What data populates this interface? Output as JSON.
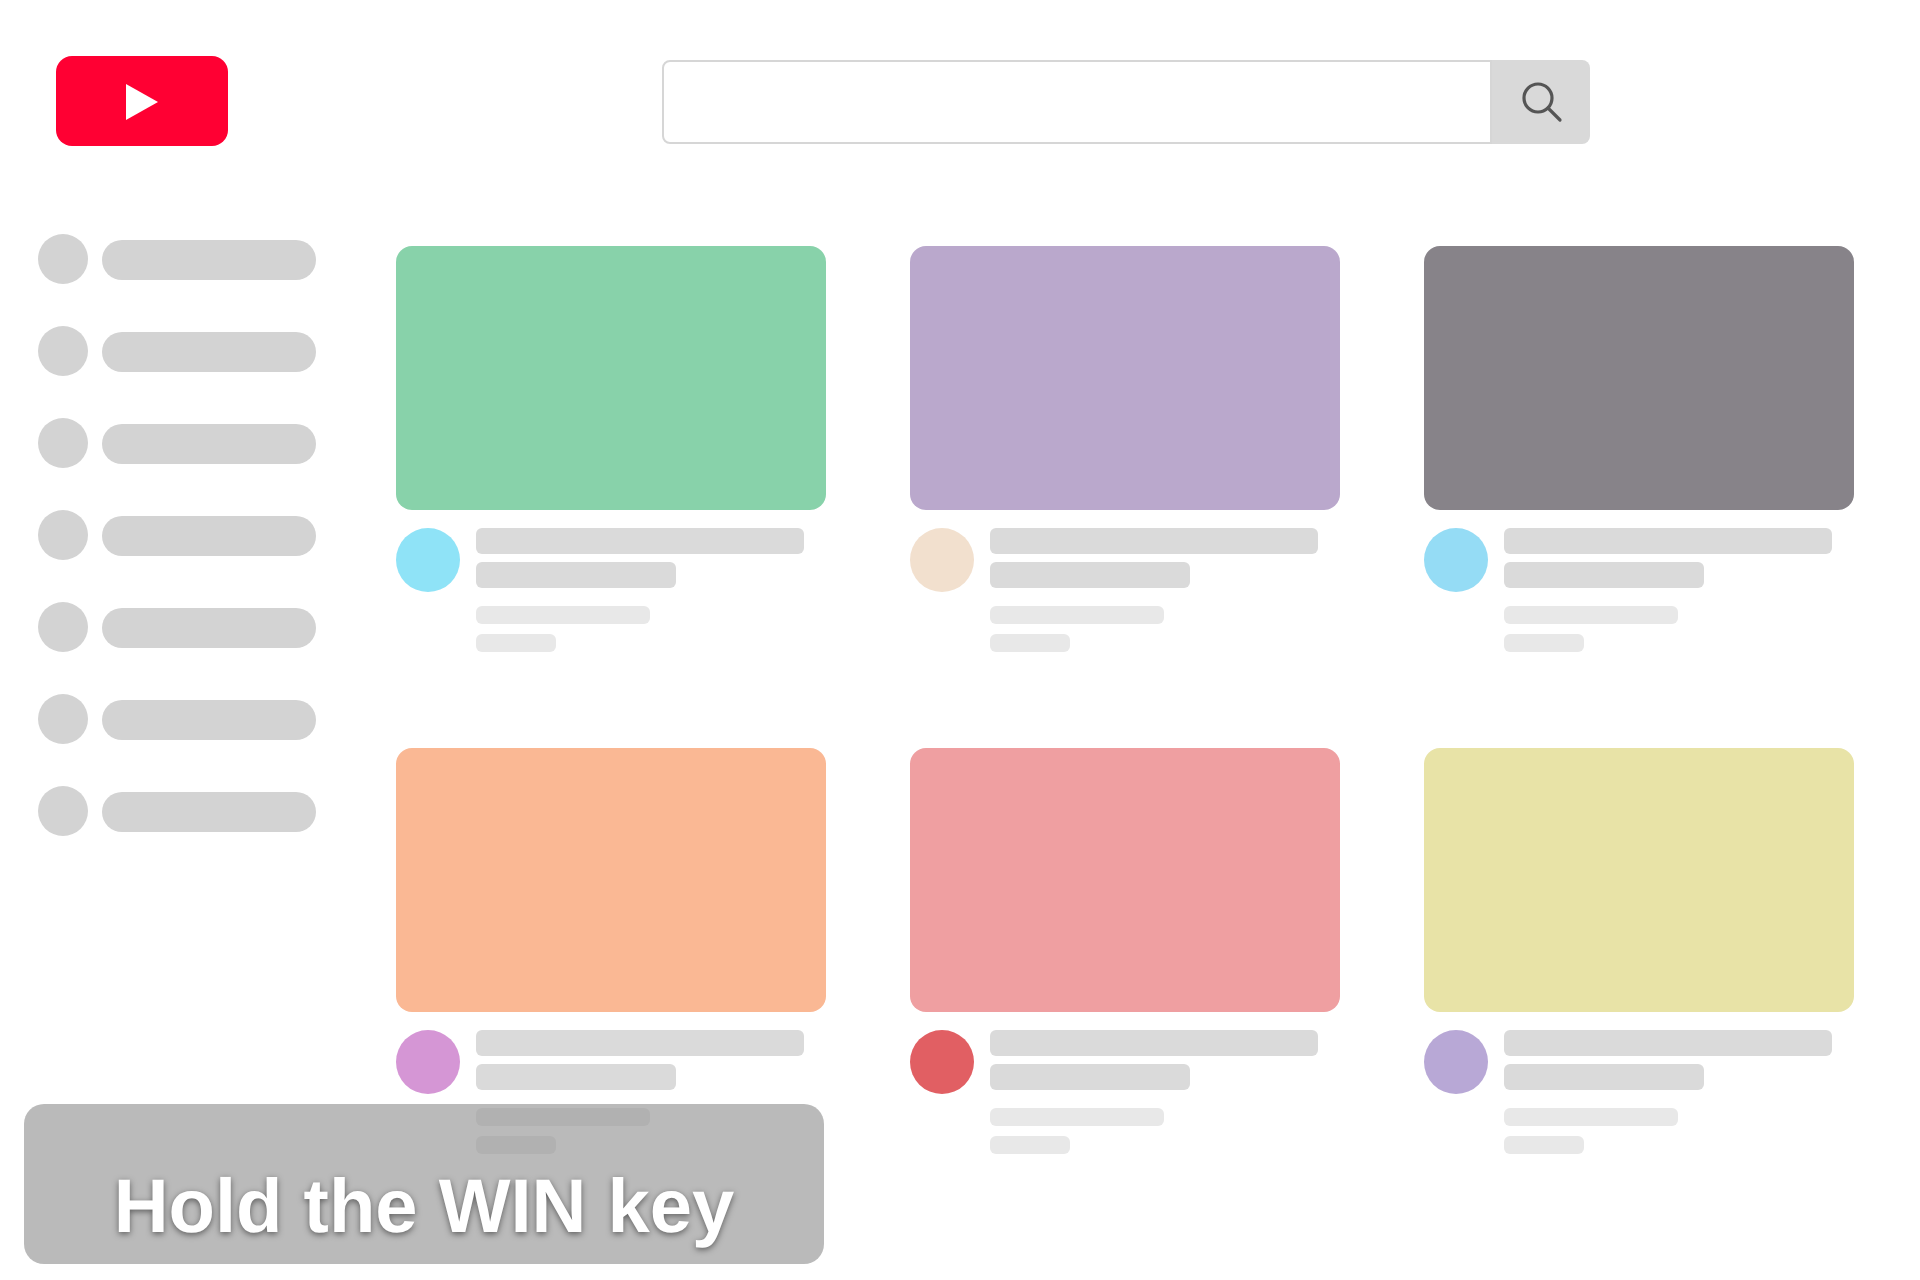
{
  "header": {
    "logo": {
      "kind": "play"
    },
    "search": {
      "kind": "empty"
    }
  },
  "sidebar": {
    "items": [
      {
        "kind": "placeholder"
      },
      {
        "kind": "placeholder"
      },
      {
        "kind": "placeholder"
      },
      {
        "kind": "placeholder"
      },
      {
        "kind": "placeholder"
      },
      {
        "kind": "placeholder"
      },
      {
        "kind": "placeholder"
      }
    ]
  },
  "videos": [
    {
      "color": "#88d2aa",
      "avatar": {
        "color": "#8fe3f7"
      }
    },
    {
      "color": "#baa8cc",
      "avatar": {
        "color": "#f2e0ce"
      }
    },
    {
      "color": "#878389",
      "avatar": {
        "color": "#95dcf5"
      }
    },
    {
      "color": "#fab894",
      "avatar": {
        "color": "#d596d5"
      }
    },
    {
      "color": "#ef9fa1",
      "avatar": {
        "color": "#e15f63"
      }
    },
    {
      "color": "#e8e3a7",
      "avatar": {
        "color": "#b8a8d6"
      }
    }
  ],
  "caption": {
    "text": "Hold the WIN key"
  }
}
